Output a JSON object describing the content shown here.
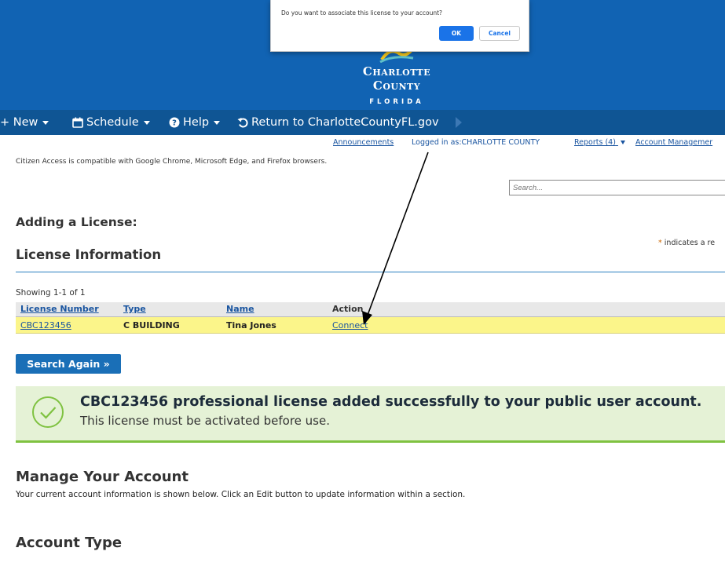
{
  "dialog": {
    "message": "Do you want to associate this license to your account?",
    "ok_label": "OK",
    "cancel_label": "Cancel"
  },
  "logo": {
    "county": "Charlotte County",
    "state": "FLORIDA"
  },
  "nav": {
    "items": [
      {
        "label": "+ New",
        "icon": "plus-icon",
        "has_caret": true
      },
      {
        "label": "Schedule",
        "icon": "calendar-icon",
        "has_caret": true
      },
      {
        "label": "Help",
        "icon": "help-circle-icon",
        "has_caret": true
      },
      {
        "label": "Return to CharlotteCountyFL.gov",
        "icon": "return-arrow-icon",
        "has_caret": false
      }
    ]
  },
  "toplinks": {
    "announcements": "Announcements",
    "logged_in": "Logged in as:CHARLOTTE COUNTY",
    "reports": "Reports (4)",
    "account_management": "Account Managemer"
  },
  "compat_note": "Citizen Access is compatible with Google Chrome, Microsoft Edge, and Firefox browsers.",
  "search": {
    "placeholder": "Search..."
  },
  "page": {
    "adding_title": "Adding a License:",
    "required_note_star": "*",
    "required_note": "indicates a re",
    "license_section_title": "License Information"
  },
  "table": {
    "showing": "Showing 1-1 of 1",
    "headers": [
      "License Number",
      "Type",
      "Name",
      "Action"
    ],
    "rows": [
      {
        "license_number": "CBC123456",
        "type": "C BUILDING",
        "name": "Tina Jones",
        "action": "Connect"
      }
    ]
  },
  "search_again_label": "Search Again »",
  "success": {
    "title": "CBC123456 professional license added successfully to your public user account.",
    "subtitle": "This license must be activated before use."
  },
  "manage": {
    "title": "Manage Your Account",
    "description": "Your current account information is shown below. Click an Edit button to update information within a section."
  },
  "account_type_title": "Account Type",
  "colors": {
    "banner": "#1163b3",
    "nav": "#0f5594",
    "link": "#1a55a0",
    "highlight_row": "#fbf58a",
    "success_bg": "#e5f2d6",
    "success_accent": "#7fc241",
    "primary_button": "#1a6fb7"
  }
}
